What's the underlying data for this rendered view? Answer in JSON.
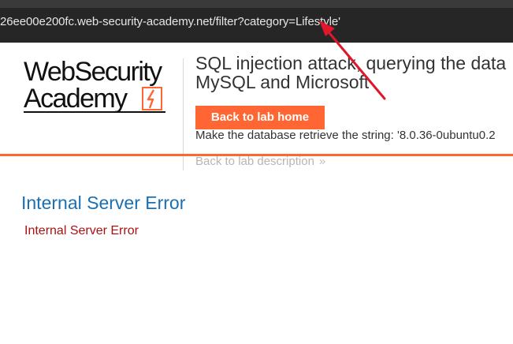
{
  "browser": {
    "url": "26ee00e200fc.web-security-academy.net/filter?category=Lifestyle'"
  },
  "header": {
    "logo": {
      "line1": "WebSecurity",
      "line2": "Academy",
      "icon": "lightning-bolt-icon"
    },
    "lab_title_line1": "SQL injection attack, querying the data",
    "lab_title_line2": "MySQL and Microsoft",
    "back_home_label": "Back to lab home",
    "lab_description": "Make the database retrieve the string: '8.0.36-0ubuntu0.2",
    "back_description_label": "Back to lab description",
    "back_description_icon": "double-chevron-right-icon"
  },
  "main": {
    "error_heading": "Internal Server Error",
    "error_message": "Internal Server Error"
  },
  "colors": {
    "accent": "#ff6633",
    "heading_blue": "#1a6fb3",
    "error_red": "#aa1111",
    "annotation_red": "#e0162b"
  }
}
